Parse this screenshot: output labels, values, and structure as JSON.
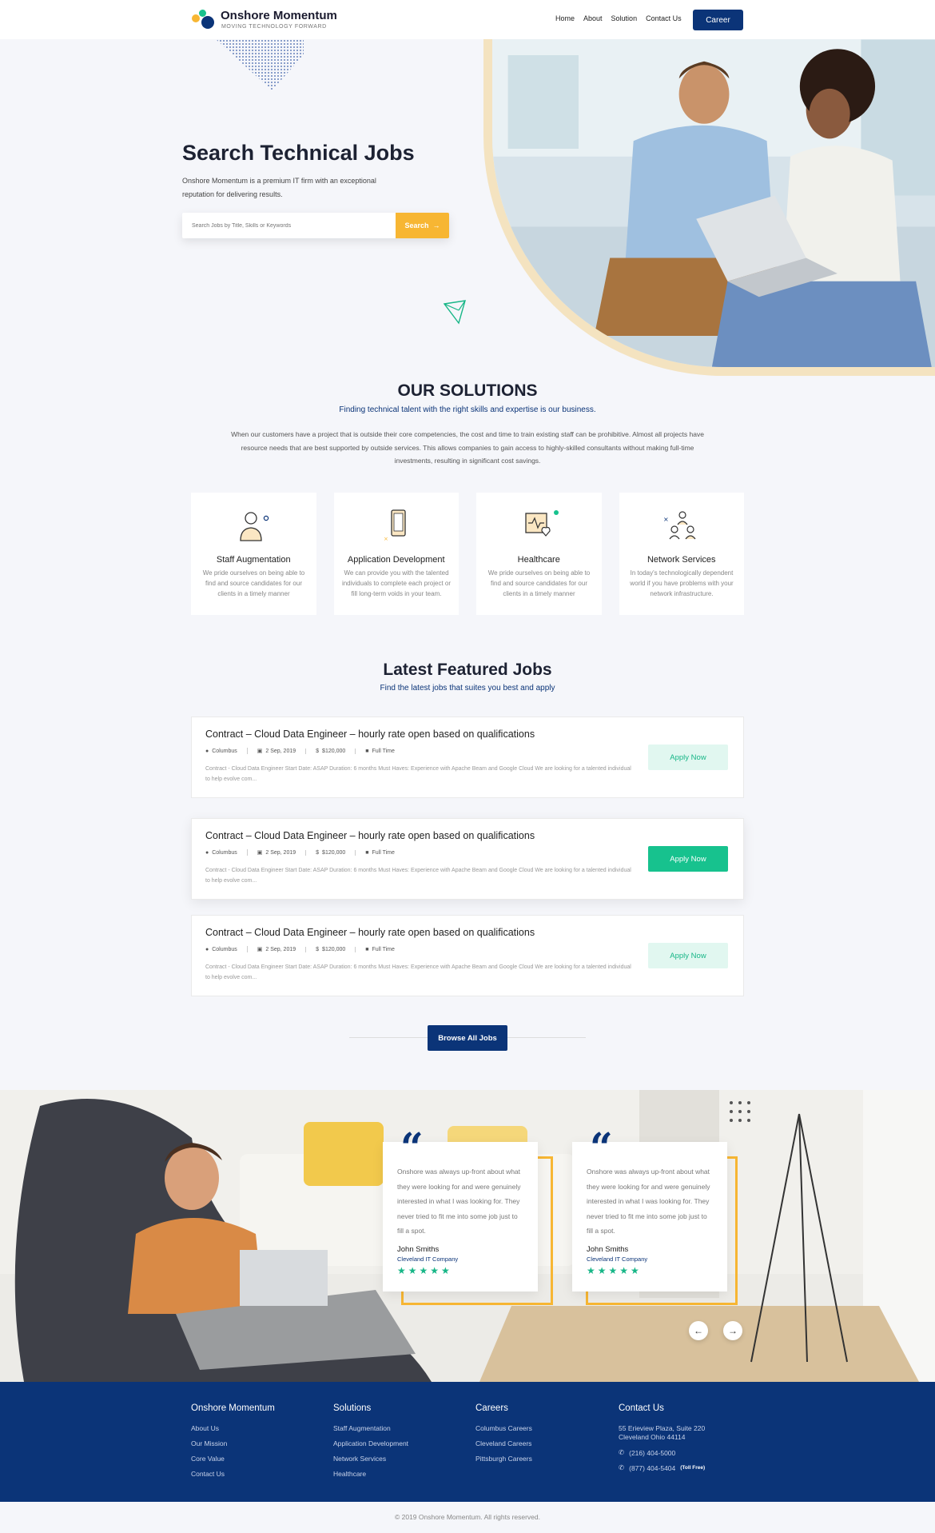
{
  "brand": {
    "name": "Onshore Momentum",
    "tagline": "MOVING TECHNOLOGY FORWARD"
  },
  "nav": {
    "items": [
      "Home",
      "About",
      "Solution",
      "Contact Us"
    ],
    "cta": "Career"
  },
  "hero": {
    "title": "Search Technical Jobs",
    "description": "Onshore Momentum is a premium IT firm with an exceptional reputation for delivering results.",
    "search_placeholder": "Search Jobs by Title, Skills or Keywords",
    "search_button": "Search"
  },
  "solutions": {
    "title": "OUR SOLUTIONS",
    "subtitle": "Finding technical talent with the right skills and expertise is our business.",
    "description": "When our customers have a project that is outside their core competencies, the cost and time to train existing staff can be prohibitive. Almost all projects have resource needs that are best supported by outside services. This allows companies to gain access to highly-skilled consultants without making full-time investments, resulting in significant cost savings.",
    "cards": [
      {
        "icon": "staff-person-icon",
        "title": "Staff Augmentation",
        "desc": "We pride ourselves on being able to find and source candidates for our clients in a timely manner"
      },
      {
        "icon": "mobile-device-icon",
        "title": "Application Development",
        "desc": "We can provide you with the talented individuals to complete each project or fill long-term voids in your team."
      },
      {
        "icon": "health-monitor-icon",
        "title": "Healthcare",
        "desc": "We pride ourselves on being able to find and source candidates for our clients in a timely manner"
      },
      {
        "icon": "network-people-icon",
        "title": "Network Services",
        "desc": "In today's technologically dependent world if you have problems with your network infrastructure."
      }
    ]
  },
  "jobs": {
    "title": "Latest Featured Jobs",
    "subtitle": "Find the latest jobs that suites you best and apply",
    "items": [
      {
        "title": "Contract – Cloud Data Engineer – hourly rate open based on qualifications",
        "location": "Columbus",
        "date": "2 Sep, 2019",
        "salary": "$120,000",
        "type": "Full Time",
        "desc": "Contract - Cloud Data Engineer Start Date: ASAP Duration: 6 months Must Haves: Experience with Apache Beam and Google Cloud   We are looking for a talented individual to help evolve com...",
        "apply": "Apply Now"
      },
      {
        "title": "Contract – Cloud Data Engineer – hourly rate open based on qualifications",
        "location": "Columbus",
        "date": "2 Sep, 2019",
        "salary": "$120,000",
        "type": "Full Time",
        "desc": "Contract - Cloud Data Engineer Start Date: ASAP Duration: 6 months Must Haves: Experience with Apache Beam and Google Cloud   We are looking for a talented individual to help evolve com...",
        "apply": "Apply Now"
      },
      {
        "title": "Contract – Cloud Data Engineer – hourly rate open based on qualifications",
        "location": "Columbus",
        "date": "2 Sep, 2019",
        "salary": "$120,000",
        "type": "Full Time",
        "desc": "Contract - Cloud Data Engineer Start Date: ASAP Duration: 6 months Must Haves: Experience with Apache Beam and Google Cloud   We are looking for a talented individual to help evolve com...",
        "apply": "Apply Now"
      }
    ],
    "browse": "Browse All Jobs"
  },
  "testimonials": [
    {
      "text": "Onshore was always up-front about what they were looking for and were genuinely interested in what I was looking for. They never tried to fit me into some job just to fill a spot.",
      "name": "John Smiths",
      "company": "Cleveland IT Company",
      "stars": "★★★★★"
    },
    {
      "text": "Onshore was always up-front about what they were looking for and were genuinely interested in what I was looking for. They never tried to fit me into some job just to fill a spot.",
      "name": "John Smiths",
      "company": "Cleveland IT Company",
      "stars": "★★★★★"
    }
  ],
  "footer": {
    "col1": {
      "title": "Onshore Momentum",
      "items": [
        "About Us",
        "Our Mission",
        "Core Value",
        "Contact Us"
      ]
    },
    "col2": {
      "title": "Solutions",
      "items": [
        "Staff Augmentation",
        "Application Development",
        "Network Services",
        "Healthcare"
      ]
    },
    "col3": {
      "title": "Careers",
      "items": [
        "Columbus Careers",
        "Cleveland Careers",
        "Pittsburgh Careers"
      ]
    },
    "col4": {
      "title": "Contact Us",
      "address1": "55 Erieview Plaza, Suite 220",
      "address2": "Cleveland Ohio 44114",
      "phone1": "(216) 404-5000",
      "phone2": "(877) 404-5404",
      "tollfree": "(Toll Free)"
    },
    "copyright": "© 2019 Onshore Momentum. All rights reserved."
  },
  "colors": {
    "primary": "#0b3478",
    "accent": "#f7b633",
    "success": "#17c28e",
    "background": "#f5f6fa"
  }
}
